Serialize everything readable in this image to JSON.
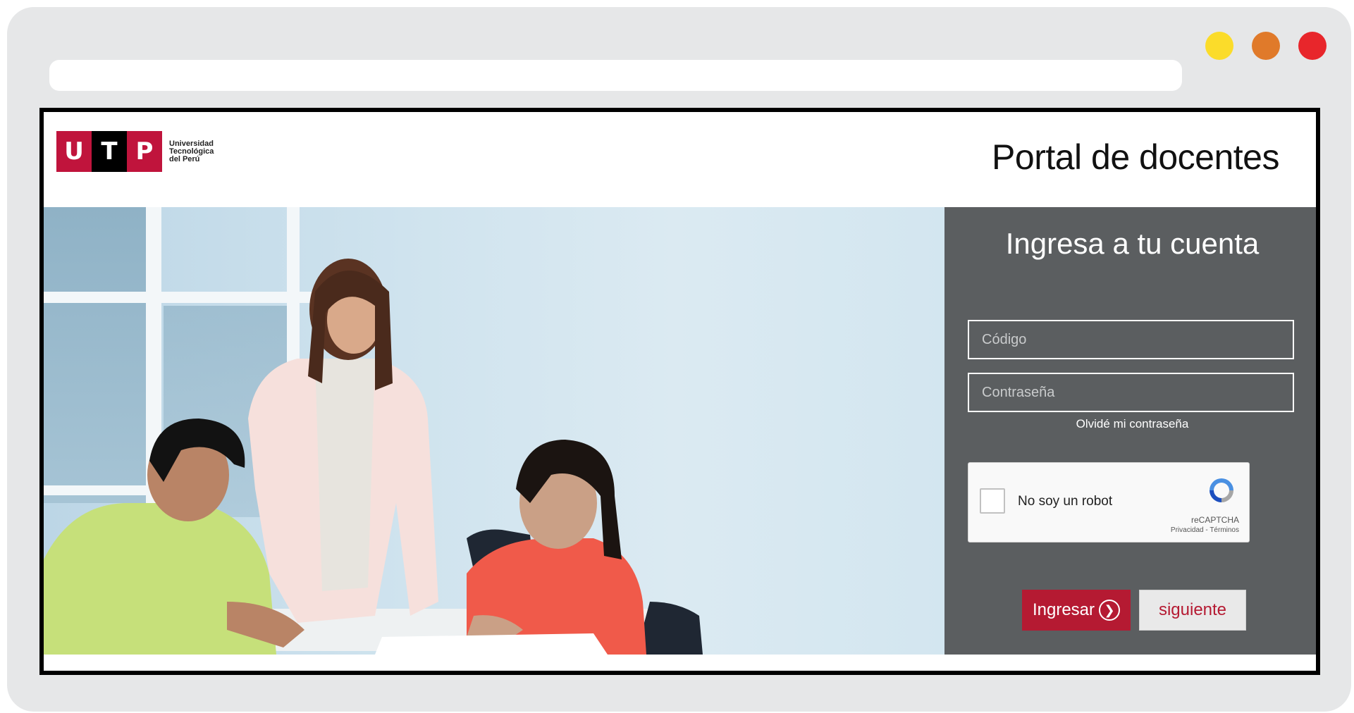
{
  "window": {
    "dots": [
      {
        "name": "minimize-dot",
        "color": "#fbdc2a"
      },
      {
        "name": "maximize-dot",
        "color": "#e07a2a"
      },
      {
        "name": "close-dot",
        "color": "#e8262b"
      }
    ]
  },
  "header": {
    "logo_letters": [
      "U",
      "T",
      "P"
    ],
    "logo_lines": [
      "Universidad",
      "Tecnológica",
      "del Perú"
    ],
    "title": "Portal de docentes"
  },
  "login": {
    "title": "Ingresa a tu cuenta",
    "code_placeholder": "Código",
    "password_placeholder": "Contraseña",
    "forgot_label": "Olvidé mi contraseña",
    "captcha": {
      "label": "No soy un robot",
      "brand": "reCAPTCHA",
      "links": "Privacidad - Términos"
    },
    "submit_label": "Ingresar",
    "next_label": "siguiente"
  },
  "colors": {
    "brand_red": "#c0143c",
    "panel_bg": "#5b5e60",
    "button_red": "#b51a32"
  }
}
